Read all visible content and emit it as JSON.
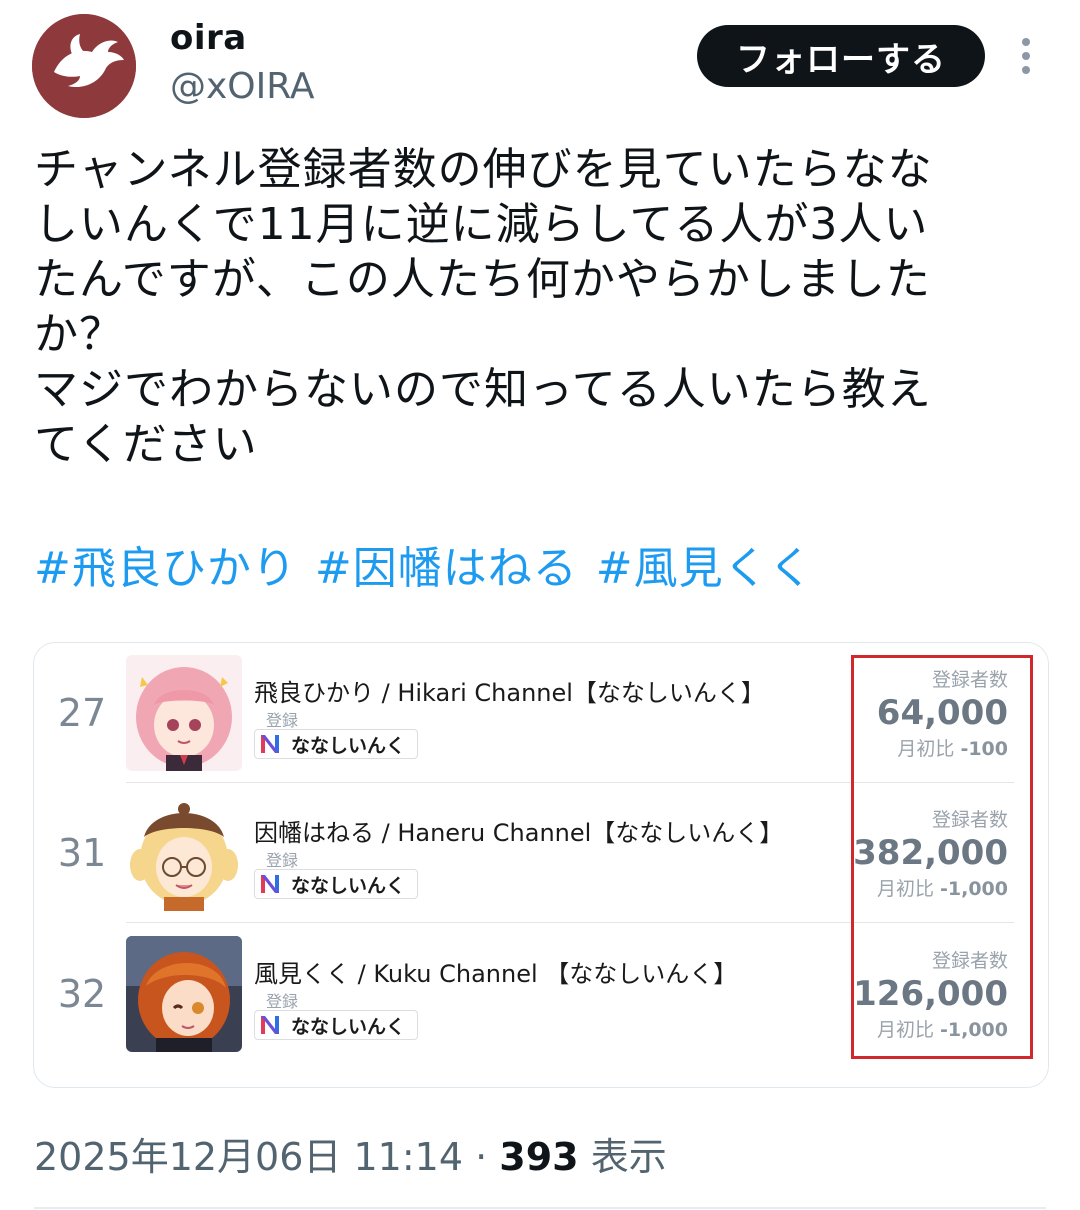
{
  "author": {
    "name": "oira",
    "handle": "@xOIRA",
    "avatar_color": "#8e3a3c"
  },
  "follow_label": "フォローする",
  "tweet": {
    "lines": [
      "チャンネル登録者数の伸びを見ていたらなな",
      "しいんくで11月に逆に減らしてる人が3人い",
      "たんですが、この人たち何かやらかしました",
      "か？",
      "マジでわからないので知ってる人いたら教え",
      "てください"
    ],
    "hashtags": [
      "#飛良ひかり",
      "#因幡はねる",
      "#風見くく"
    ],
    "hashtag_color": "#1d9bf0"
  },
  "card": {
    "rows": [
      {
        "rank": "27",
        "channel": "飛良ひかり / Hikari Channel【ななしいんく】",
        "reg_label": "登録",
        "org": "ななしいんく",
        "stat_label": "登録者数",
        "subscribers": "64,000",
        "change_label": "月初比",
        "change": "-100"
      },
      {
        "rank": "31",
        "channel": "因幡はねる / Haneru Channel【ななしいんく】",
        "reg_label": "登録",
        "org": "ななしいんく",
        "stat_label": "登録者数",
        "subscribers": "382,000",
        "change_label": "月初比",
        "change": "-1,000"
      },
      {
        "rank": "32",
        "channel": "風見くく / Kuku Channel 【ななしいんく】",
        "reg_label": "登録",
        "org": "ななしいんく",
        "stat_label": "登録者数",
        "subscribers": "126,000",
        "change_label": "月初比",
        "change": "-1,000"
      }
    ],
    "highlight_color": "#d0282c"
  },
  "meta": {
    "timestamp": "2025年12月06日 11:14",
    "separator": "·",
    "views": "393",
    "views_label": "表示"
  }
}
